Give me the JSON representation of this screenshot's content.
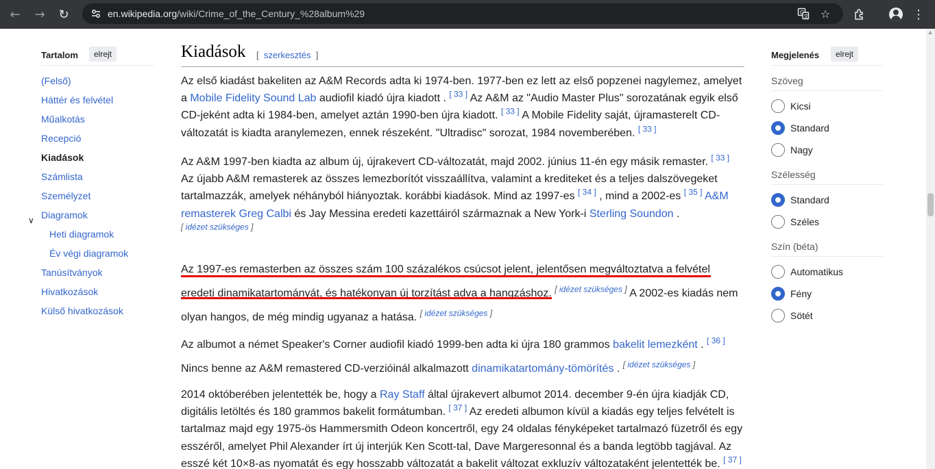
{
  "browser": {
    "url_host": "en.wikipedia.org",
    "url_path": "/wiki/Crime_of_the_Century_%28album%29"
  },
  "toc": {
    "title": "Tartalom",
    "hide_label": "elrejt",
    "items": [
      {
        "label": "(Felső)"
      },
      {
        "label": "Háttér és felvétel"
      },
      {
        "label": "Műalkotás"
      },
      {
        "label": "Recepció"
      },
      {
        "label": "Kiadások"
      },
      {
        "label": "Számlista"
      },
      {
        "label": "Személyzet"
      },
      {
        "label": "Diagramok"
      },
      {
        "label": "Heti diagramok"
      },
      {
        "label": "Év végi diagramok"
      },
      {
        "label": "Tanúsítványok"
      },
      {
        "label": "Hivatkozások"
      },
      {
        "label": "Külső hivatkozások"
      }
    ]
  },
  "section": {
    "heading": "Kiadások",
    "edit_label": "szerkesztés"
  },
  "cn_label": "idézet szükséges",
  "p1": {
    "t1": "Az első kiadást bakeliten az A&M Records adta ki 1974-ben. 1977-ben ez lett az első popzenei nagylemez, amelyet a ",
    "link1": "Mobile Fidelity Sound Lab",
    "t2": " audiofil kiadó újra kiadott . ",
    "ref1": "[ 33 ]",
    "t3": " Az A&M az \"Audio Master Plus\" sorozatának egyik első CD-jeként adta ki 1984-ben, amelyet aztán 1990-ben újra kiadott. ",
    "ref2": "[ 33 ]",
    "t4": " A Mobile Fidelity saját, újramasterelt CD-változatát is kiadta aranylemezen, ennek részeként. \"Ultradisc\" sorozat, 1984 novemberében. ",
    "ref3": "[ 33 ]"
  },
  "p2": {
    "t1": "Az A&M 1997-ben kiadta az album új, újrakevert CD-változatát, majd 2002. június 11-én egy másik remaster. ",
    "ref1": "[ 33 ]",
    "t2": " Az újabb A&M remasterek az összes lemezborítót visszaállítva, valamint a krediteket és a teljes dalszövegeket tartalmazzák, amelyek néhányból hiányoztak. korábbi kiadások. Mind az 1997-es ",
    "ref2": "[ 34 ]",
    "t3": " , mind a 2002-es ",
    "ref3": "[ 35 ]",
    "t4": " ",
    "link1": "A&M remasterek Greg Calbi",
    "t5": " és Jay Messina eredeti kazettáiról származnak a New York-i ",
    "link2": "Sterling Soundon",
    "t6": " . "
  },
  "p3": {
    "line1": "Az 1997-es remasterben az összes szám 100 százalékos csúcsot jelent, jelentősen megváltoztatva a felvétel",
    "line2": "eredeti dinamikatartományát, és hatékonyan új torzítást adva a hangzáshoz.",
    "t3": " A 2002-es kiadás nem",
    "line3": "olyan hangos, de még mindig ugyanaz a hatása. "
  },
  "p4": {
    "t1": "Az albumot a német Speaker's Corner audiofil kiadó 1999-ben adta ki újra 180 grammos ",
    "link1": "bakelit lemezként",
    "t2": " . ",
    "ref1": "[ 36 ]",
    "t3": "Nincs benne az A&M remastered CD-verzióinál alkalmazott ",
    "link2": "dinamikatartomány-tömörítés",
    "t4": " . "
  },
  "p5": {
    "t1": "2014 októberében jelentették be, hogy a ",
    "link1": "Ray Staff",
    "t2": " által újrakevert albumot 2014. december 9-én újra kiadják CD, digitális letöltés és 180 grammos bakelit formátumban. ",
    "ref1": "[ 37 ]",
    "t3": " Az eredeti albumon kívül a kiadás egy teljes felvételt is tartalmaz majd egy 1975-ös Hammersmith Odeon koncertről, egy 24 oldalas fényképeket tartalmazó füzetről és egy esszéről, amelyet Phil Alexander írt új interjúk Ken Scott-tal, Dave Margeresonnal és a banda legtöbb tagjával. Az esszé két 10×8-as nyomatát és egy hosszabb változatát a bakelit változat exkluzív változataként jelentették be. ",
    "ref2": "[ 37 ]"
  },
  "appearance": {
    "title": "Megjelenés",
    "hide_label": "elrejt",
    "text_label": "Szöveg",
    "text_options": [
      "Kicsi",
      "Standard",
      "Nagy"
    ],
    "width_label": "Szélesség",
    "width_options": [
      "Standard",
      "Széles"
    ],
    "color_label": "Szín (béta)",
    "color_options": [
      "Automatikus",
      "Fény",
      "Sötét"
    ]
  },
  "colors": {
    "link": "#3366cc",
    "highlight_underline": "#e60000",
    "chrome_bg": "#35363a"
  }
}
